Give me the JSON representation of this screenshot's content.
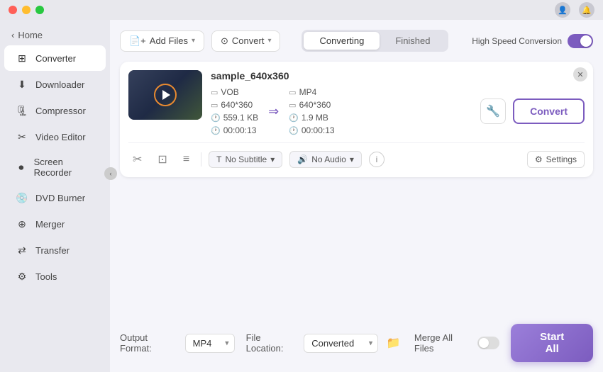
{
  "titleBar": {
    "trafficLights": [
      "red",
      "yellow",
      "green"
    ]
  },
  "sidebar": {
    "homeLabel": "Home",
    "items": [
      {
        "id": "converter",
        "label": "Converter",
        "icon": "⊞",
        "active": true
      },
      {
        "id": "downloader",
        "label": "Downloader",
        "icon": "↓",
        "active": false
      },
      {
        "id": "compressor",
        "label": "Compressor",
        "icon": "⊙",
        "active": false
      },
      {
        "id": "video-editor",
        "label": "Video Editor",
        "icon": "✂",
        "active": false
      },
      {
        "id": "screen-recorder",
        "label": "Screen Recorder",
        "icon": "⊡",
        "active": false
      },
      {
        "id": "dvd-burner",
        "label": "DVD Burner",
        "icon": "◎",
        "active": false
      },
      {
        "id": "merger",
        "label": "Merger",
        "icon": "⊕",
        "active": false
      },
      {
        "id": "transfer",
        "label": "Transfer",
        "icon": "⇄",
        "active": false
      },
      {
        "id": "tools",
        "label": "Tools",
        "icon": "⚙",
        "active": false
      }
    ]
  },
  "toolbar": {
    "addFileLabel": "Add Files",
    "addDropdownChevron": "▾",
    "convertDropdownLabel": "Convert",
    "convertDropdownChevron": "▾"
  },
  "tabs": {
    "converting": "Converting",
    "finished": "Finished",
    "activeTab": "converting"
  },
  "speedToggle": {
    "label": "High Speed Conversion",
    "enabled": true
  },
  "fileCard": {
    "fileName": "sample_640x360",
    "source": {
      "format": "VOB",
      "resolution": "640*360",
      "fileSize": "559.1 KB",
      "duration": "00:00:13"
    },
    "target": {
      "format": "MP4",
      "resolution": "640*360",
      "fileSize": "1.9 MB",
      "duration": "00:00:13"
    },
    "convertBtnLabel": "Convert",
    "subtitleLabel": "No Subtitle",
    "audioLabel": "No Audio",
    "settingsLabel": "Settings"
  },
  "bottomBar": {
    "outputFormatLabel": "Output Format:",
    "outputFormatValue": "MP4",
    "fileLocationLabel": "File Location:",
    "fileLocationValue": "Converted",
    "mergeAllFilesLabel": "Merge All Files",
    "startAllLabel": "Start All"
  }
}
